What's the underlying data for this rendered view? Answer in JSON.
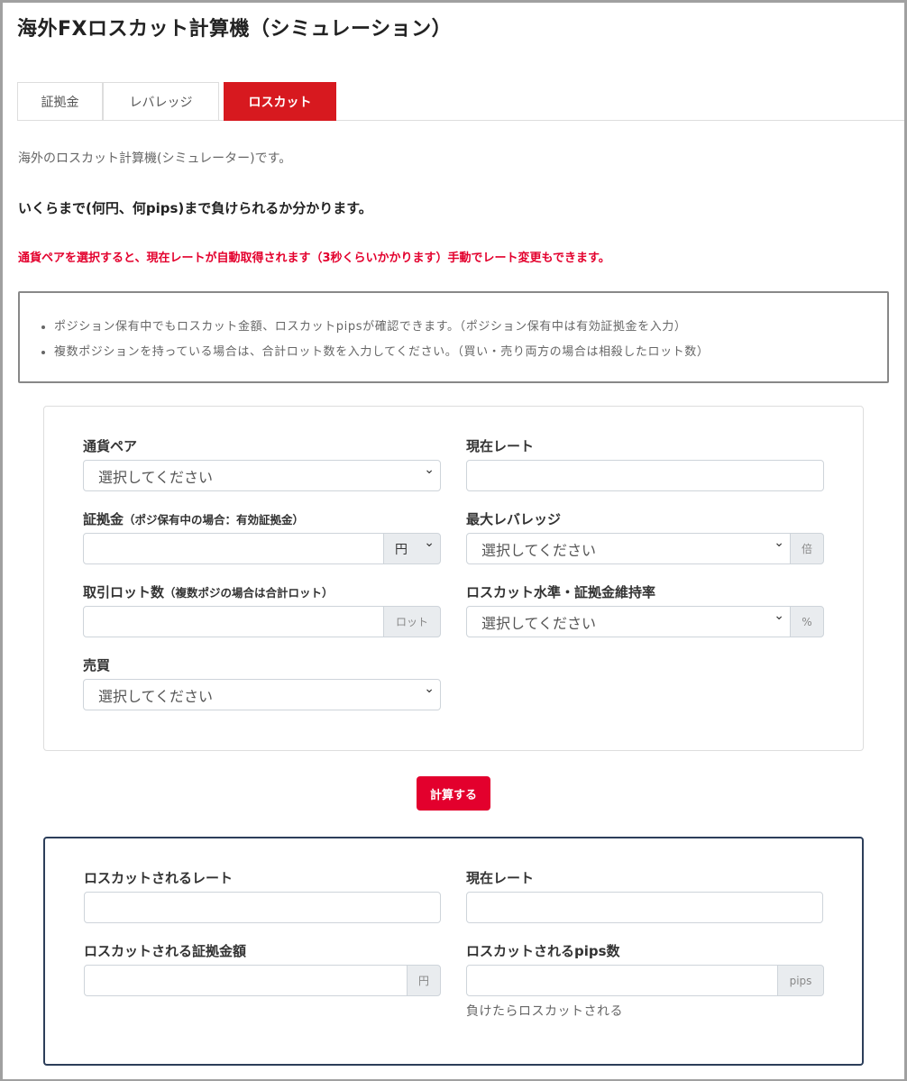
{
  "title": "海外FXロスカット計算機（シミュレーション）",
  "tabs": [
    {
      "label": "証拠金"
    },
    {
      "label": "レバレッジ"
    },
    {
      "label": "ロスカット"
    }
  ],
  "intro": "海外のロスカット計算機(シミュレーター)です。",
  "subtitle": "いくらまで(何円、何pips)まで負けられるか分かります。",
  "alert": "通貨ペアを選択すると、現在レートが自動取得されます（3秒くらいかかります）手動でレート変更もできます。",
  "notes": [
    "ポジション保有中でもロスカット金額、ロスカットpipsが確認できます。（ポジション保有中は有効証拠金を入力）",
    "複数ポジションを持っている場合は、合計ロット数を入力してください。（買い・売り両方の場合は相殺したロット数）"
  ],
  "form": {
    "pair": {
      "label": "通貨ペア",
      "value": "選択してください"
    },
    "rate": {
      "label": "現在レート",
      "value": ""
    },
    "margin": {
      "label": "証拠金",
      "note": "（ポジ保有中の場合：有効証拠金）",
      "unit": "円"
    },
    "leverage": {
      "label": "最大レバレッジ",
      "value": "選択してください",
      "unit": "倍"
    },
    "lots": {
      "label": "取引ロット数",
      "note": "（複数ポジの場合は合計ロット）",
      "unit": "ロット"
    },
    "level": {
      "label": "ロスカット水準・証拠金維持率",
      "value": "選択してください",
      "unit": "%"
    },
    "side": {
      "label": "売買",
      "value": "選択してください"
    }
  },
  "calc_button": "計算する",
  "result": {
    "losscut_rate": {
      "label": "ロスカットされるレート"
    },
    "current_rate": {
      "label": "現在レート"
    },
    "losscut_margin": {
      "label": "ロスカットされる証拠金額",
      "unit": "円"
    },
    "losscut_pips": {
      "label": "ロスカットされるpips数",
      "unit": "pips",
      "help": "負けたらロスカットされる"
    }
  },
  "colors": {
    "accent": "#d7191f",
    "alert": "#e3002d",
    "result_border": "#2c3e5a"
  }
}
